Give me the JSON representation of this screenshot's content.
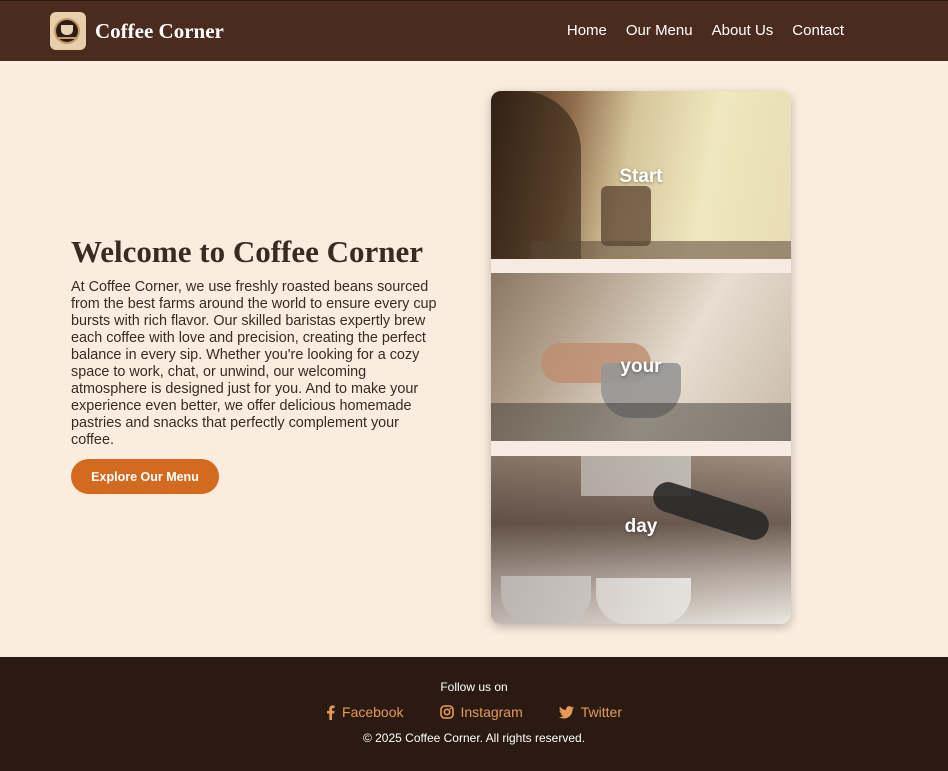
{
  "brand": {
    "name": "Coffee Corner",
    "logo_icon": "coffee-cup-logo"
  },
  "nav": {
    "items": [
      {
        "label": "Home"
      },
      {
        "label": "Our Menu"
      },
      {
        "label": "About Us"
      },
      {
        "label": "Contact"
      }
    ]
  },
  "hero": {
    "title": "Welcome to Coffee Corner",
    "paragraph": "At Coffee Corner, we use freshly roasted beans sourced from the best farms around the world to ensure every cup bursts with rich flavor. Our skilled baristas expertly brew each coffee with love and precision, creating the perfect balance in every sip. Whether you're looking for a cozy space to work, chat, or unwind, our welcoming atmosphere is designed just for you. And to make your experience even better, we offer delicious homemade pastries and snacks that perfectly complement your coffee.",
    "cta_label": "Explore Our Menu"
  },
  "panels": [
    {
      "word": "Start"
    },
    {
      "word": "your"
    },
    {
      "word": "day"
    }
  ],
  "footer": {
    "follow_label": "Follow us on",
    "socials": [
      {
        "label": "Facebook",
        "icon": "facebook-icon"
      },
      {
        "label": "Instagram",
        "icon": "instagram-icon"
      },
      {
        "label": "Twitter",
        "icon": "twitter-icon"
      }
    ],
    "copyright": "© 2025 Coffee Corner. All rights reserved."
  },
  "colors": {
    "header": "#4a2b1d",
    "background": "#faeddf",
    "accent": "#d26a1f",
    "footer": "#2a1a12",
    "social_link": "#e49a55"
  }
}
